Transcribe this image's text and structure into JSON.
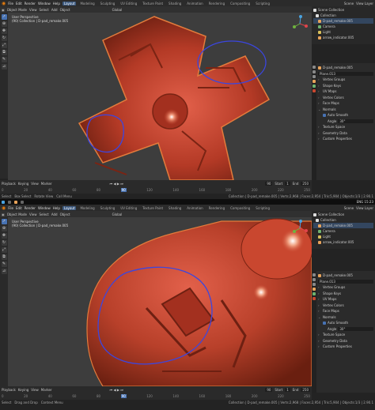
{
  "menu": {
    "items": [
      "File",
      "Edit",
      "Render",
      "Window",
      "Help"
    ],
    "workspaces": [
      "Layout",
      "Modeling",
      "Sculpting",
      "UV Editing",
      "Texture Paint",
      "Shading",
      "Animation",
      "Rendering",
      "Compositing",
      "Scripting"
    ],
    "active_workspace": "Layout",
    "scene": "Scene",
    "view_layer": "View Layer"
  },
  "header": {
    "mode": "Object Mode",
    "view": "View",
    "select": "Select",
    "add": "Add",
    "object": "Object",
    "orientation": "Global"
  },
  "viewport": {
    "perspective": "User Perspective",
    "collection": "(90) Collection | D-pad_remake.005"
  },
  "outliner": {
    "title": "Scene Collection",
    "items": [
      {
        "label": "Collection",
        "color": "#ddd"
      },
      {
        "label": "D-pad_remake.005",
        "color": "#e8a35a"
      },
      {
        "label": "Camera",
        "color": "#6fb36f"
      },
      {
        "label": "Light",
        "color": "#d8c05a"
      },
      {
        "label": "arrow_indicator.005",
        "color": "#e8a35a"
      }
    ]
  },
  "properties": {
    "object_name": "D-pad_remake.005",
    "mesh_name": "Plane.013",
    "sections": [
      "Vertex Groups",
      "Shape Keys",
      "UV Maps",
      "Vertex Colors",
      "Face Maps",
      "Normals"
    ],
    "auto_smooth": "Auto Smooth",
    "angle_label": "Angle",
    "angle_value": "30°",
    "more_sections": [
      "Texture Space",
      "Geometry Data",
      "Custom Properties"
    ]
  },
  "timeline": {
    "playback": "Playback",
    "keying": "Keying",
    "view": "View",
    "marker": "Marker",
    "current_frame": "90",
    "start_label": "Start",
    "start": "1",
    "end_label": "End",
    "end": "250",
    "ticks": [
      "0",
      "10",
      "20",
      "30",
      "40",
      "50",
      "60",
      "70",
      "80",
      "90",
      "100",
      "110",
      "120",
      "130",
      "140",
      "150",
      "160",
      "170",
      "180",
      "190",
      "200",
      "210",
      "220",
      "230",
      "240",
      "250"
    ]
  },
  "status": {
    "select": "Select",
    "box_select": "Box Select",
    "rotate": "Rotate View",
    "call_menu": "Call Menu",
    "stats": "Collection | D-pad_remake.005 | Verts:2,968 | Faces:2,954 | Tris:5,904 | Objects:1/3 | 2.90.1"
  },
  "taskbar": {
    "lang": "ENG",
    "time": "15:23"
  },
  "bottom": {
    "status_select": "Select",
    "status_drag": "Drag and Drop",
    "context_menu": "Context Menu"
  },
  "colors": {
    "accent": "#4772b3",
    "object": "#c9472f",
    "annotation": "#3b46e0"
  }
}
